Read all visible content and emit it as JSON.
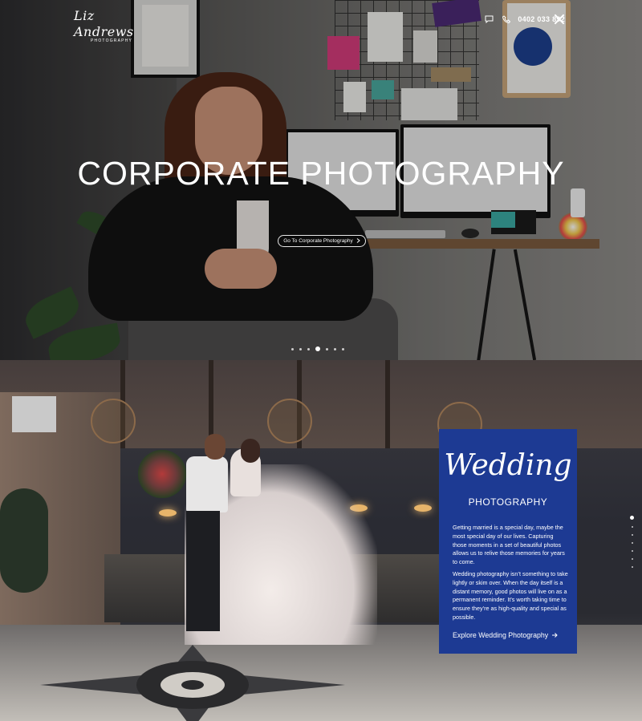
{
  "brand": {
    "logo_script": "Liz Andrews",
    "logo_sub": "PHOTOGRAPHY"
  },
  "topbar": {
    "chat_icon": "chat-icon",
    "phone_icon": "phone-icon",
    "phone": "0402 033 892",
    "close_icon": "close-icon"
  },
  "hero": {
    "title": "CORPORATE PHOTOGRAPHY",
    "button": "Go To Corporate Photography",
    "button_icon": "chevron-right-icon",
    "slides": 7,
    "active_slide": 4
  },
  "wedding": {
    "script_title": "Wedding",
    "subtitle": "PHOTOGRAPHY",
    "paragraph1": "Getting married is a special day, maybe the most special day of our lives. Capturing those moments in a set of beautiful photos allows us to relive those memories for years to come.",
    "paragraph2": "Wedding photography isn’t something to take lightly or skim over. When the day itself is a distant memory, good photos will live on as a permanent reminder. It’s worth taking time to ensure they’re as high-quality and special as possible.",
    "explore": "Explore Wedding Photography",
    "explore_icon": "arrow-right-icon",
    "section_count": 7,
    "active_section": 1
  },
  "colors": {
    "card_blue": "#1d3a93",
    "text_white": "#ffffff"
  }
}
